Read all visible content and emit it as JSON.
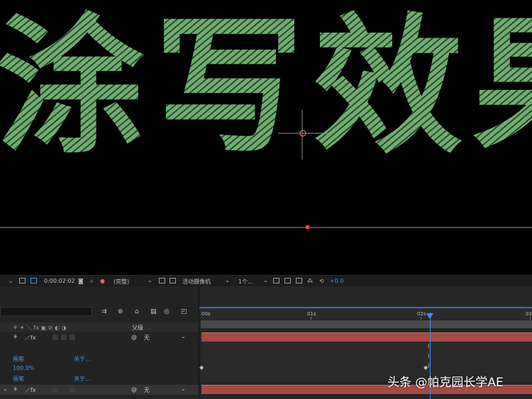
{
  "viewer": {
    "title_text": "涂写效果"
  },
  "toolbar": {
    "timecode": "0:00:02:02",
    "quality": "(完整)",
    "camera": "活动摄像机",
    "views": "1个...",
    "exposure": "+0.0"
  },
  "timeline": {
    "parent_header": "父级",
    "layers": [
      {
        "parent": "无"
      },
      {
        "parent": "无"
      }
    ],
    "properties": [
      {
        "name": "画笔",
        "link": "关于..."
      },
      {
        "name": "画笔",
        "link": "关于..."
      }
    ],
    "value": "100.0%",
    "ruler_labels": [
      "00s",
      "01s",
      "02s",
      "03"
    ]
  },
  "watermark": "头条 @帕克园长学AE",
  "colors": {
    "title_green": "#67a66a",
    "cti_blue": "#3d8bff",
    "layer_red": "#a34b44"
  }
}
